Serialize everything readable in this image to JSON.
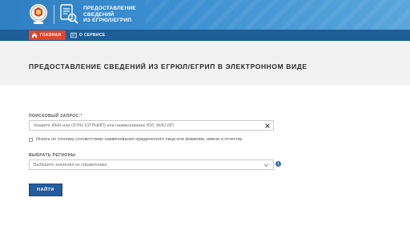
{
  "header": {
    "service_title_lines": [
      "ПРЕДОСТАВЛЕНИЕ",
      "СВЕДЕНИЙ",
      "ИЗ ЕГРЮЛ/ЕГРИП"
    ],
    "colors": {
      "header_blue": "#3b8fd0",
      "nav_blue": "#1e5d97",
      "accent_red": "#e0452a"
    },
    "emblem_icon": "fns-emblem-icon",
    "service_icon": "document-magnifier-icon"
  },
  "nav": {
    "home_label": "ГЛАВНАЯ",
    "home_icon": "home-icon",
    "about_label": "О СЕРВИСЕ",
    "about_icon": "info-card-icon"
  },
  "page": {
    "title": "ПРЕДОСТАВЛЕНИЕ СВЕДЕНИЙ ИЗ ЕГРЮЛ/ЕГРИП В ЭЛЕКТРОННОМ ВИДЕ"
  },
  "form": {
    "query_label": "ПОИСКОВЫЙ ЗАПРОС:",
    "query_required_mark": "*",
    "query_placeholder": "Укажите ИНН или ОГРН (ОГРНИП) или наименование ЮЛ, ФИО ИП",
    "exact_match_label": "Искать по точному соответствию наименования юридического лица или фамилии, имени и отчеству",
    "exact_match_checked": false,
    "regions_label": "ВЫБРАТЬ РЕГИОНЫ:",
    "regions_placeholder": "Выберите значения из справочника",
    "info_symbol": "i",
    "submit_label": "НАЙТИ"
  }
}
